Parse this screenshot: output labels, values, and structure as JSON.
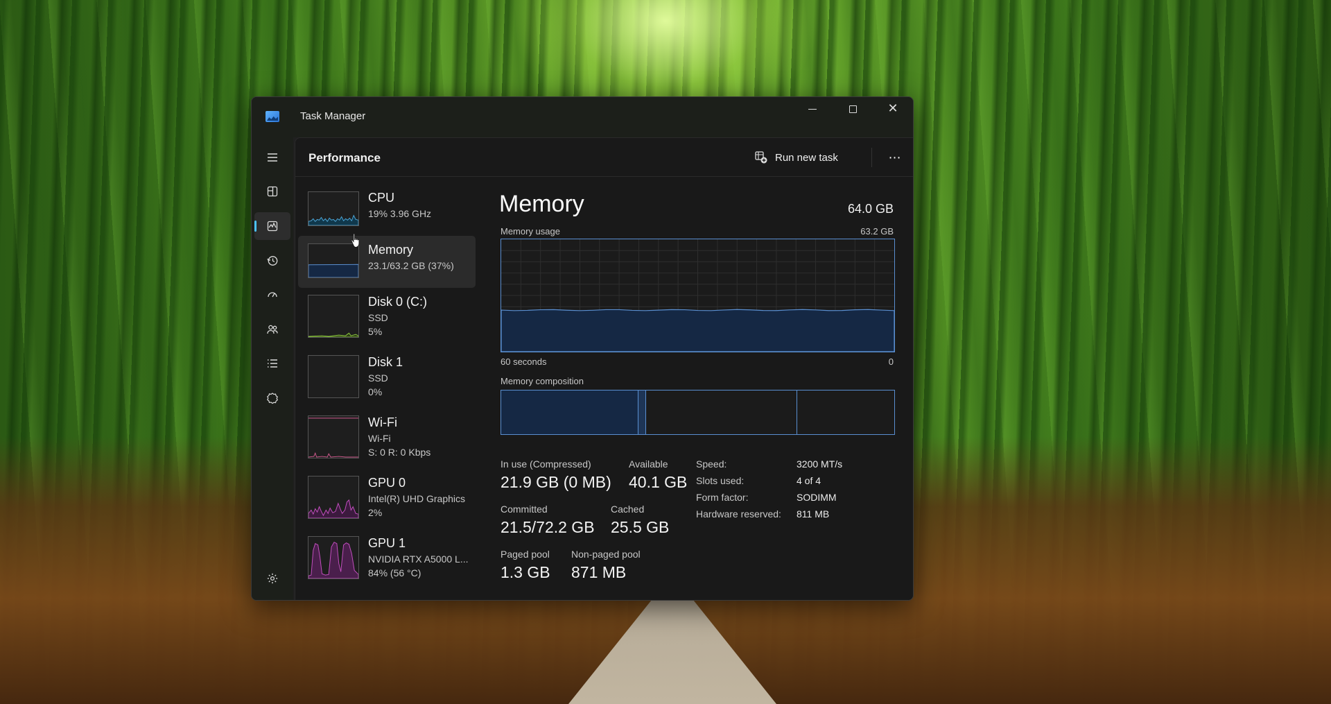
{
  "window": {
    "title": "Task Manager"
  },
  "nav": {
    "items": [
      {
        "icon": "hamburger-menu-icon"
      },
      {
        "icon": "processes-icon"
      },
      {
        "icon": "performance-icon",
        "active": true
      },
      {
        "icon": "app-history-icon"
      },
      {
        "icon": "startup-apps-icon"
      },
      {
        "icon": "users-icon"
      },
      {
        "icon": "details-icon"
      },
      {
        "icon": "services-icon"
      },
      {
        "icon": "settings-icon"
      }
    ]
  },
  "header": {
    "title": "Performance",
    "run_new_task": "Run new task",
    "more": "⋯"
  },
  "devices": [
    {
      "name": "CPU",
      "sub1": "19%  3.96 GHz",
      "sub2": "",
      "color": "#4ca6d8"
    },
    {
      "name": "Memory",
      "sub1": "23.1/63.2 GB (37%)",
      "sub2": "",
      "color": "#5a8fd1",
      "selected": true
    },
    {
      "name": "Disk 0 (C:)",
      "sub1": "SSD",
      "sub2": "5%",
      "color": "#8cc63f"
    },
    {
      "name": "Disk 1",
      "sub1": "SSD",
      "sub2": "0%",
      "color": "#8cc63f"
    },
    {
      "name": "Wi-Fi",
      "sub1": "Wi-Fi",
      "sub2": "S: 0  R: 0 Kbps",
      "color": "#d05a8e"
    },
    {
      "name": "GPU 0",
      "sub1": "Intel(R) UHD Graphics",
      "sub2": "2%",
      "color": "#c44fc0"
    },
    {
      "name": "GPU 1",
      "sub1": "NVIDIA RTX A5000 L...",
      "sub2": "84%  (56 °C)",
      "color": "#c44fc0"
    }
  ],
  "memory": {
    "title": "Memory",
    "total": "64.0 GB",
    "usage_label": "Memory usage",
    "usage_max": "63.2 GB",
    "time_left": "60 seconds",
    "time_right": "0",
    "composition_label": "Memory composition",
    "usage_fraction": 0.37,
    "stats": {
      "in_use_label": "In use (Compressed)",
      "in_use_value": "21.9 GB (0 MB)",
      "available_label": "Available",
      "available_value": "40.1 GB",
      "committed_label": "Committed",
      "committed_value": "21.5/72.2 GB",
      "cached_label": "Cached",
      "cached_value": "25.5 GB",
      "paged_label": "Paged pool",
      "paged_value": "1.3 GB",
      "nonpaged_label": "Non-paged pool",
      "nonpaged_value": "871 MB"
    },
    "details": {
      "speed_label": "Speed:",
      "speed_value": "3200 MT/s",
      "slots_label": "Slots used:",
      "slots_value": "4 of 4",
      "form_label": "Form factor:",
      "form_value": "SODIMM",
      "reserved_label": "Hardware reserved:",
      "reserved_value": "811 MB"
    }
  },
  "colors": {
    "accent": "#4cc2ff",
    "memory_line": "#5a8fd1",
    "memory_fill": "#152844"
  }
}
